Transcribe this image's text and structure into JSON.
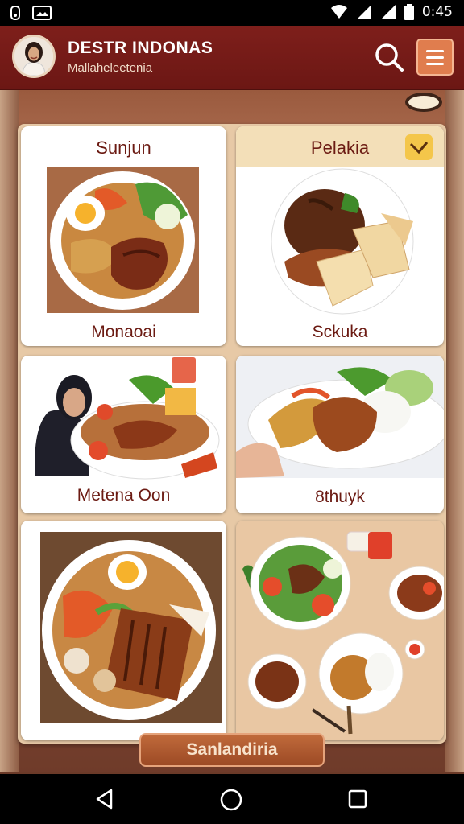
{
  "status_bar": {
    "time": "0:45",
    "icons": [
      "notification-icon",
      "screenshot-icon",
      "wifi-icon",
      "signal-icon",
      "battery-icon"
    ]
  },
  "header": {
    "title": "DESTR INDONAS",
    "subtitle": "Mallaheleetenia",
    "search_icon": "search-icon",
    "menu_icon": "hamburger-menu-icon",
    "menu_color": "#e07d4e"
  },
  "cards": [
    {
      "title": "Sunjun",
      "label": "Monaoai",
      "image": "noodle-plate-with-egg-and-grilled-chicken"
    },
    {
      "title": "Pelakia",
      "label": "Sckuka",
      "image": "rendang-with-roti-bread",
      "selected": true
    },
    {
      "label": "Metena Oon",
      "image": "woman-with-chicken-salad-bowl"
    },
    {
      "label": "8thuyk",
      "image": "fried-chicken-with-noodles-and-rice"
    },
    {
      "image": "noodles-with-grilled-fish-and-egg"
    },
    {
      "image": "assorted-dishes-spread"
    }
  ],
  "primary_button": {
    "label": "Sanlandiria"
  },
  "nav_bar": {
    "back_icon": "back-triangle-icon",
    "home_icon": "home-circle-icon",
    "recents_icon": "recents-square-icon"
  },
  "colors": {
    "header": "#7e1f1b",
    "accent": "#e07d4e",
    "text_dark": "#6b1a12",
    "check": "#f4c64a"
  }
}
